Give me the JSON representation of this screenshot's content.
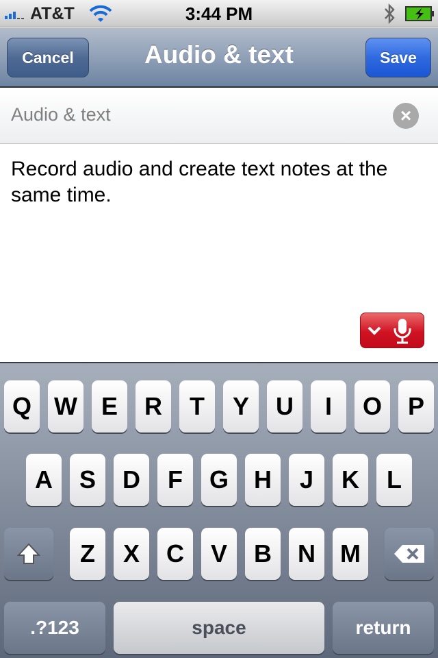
{
  "status_bar": {
    "carrier": "AT&T",
    "time": "3:44 PM",
    "signal_bars": 3,
    "battery": "charging",
    "icons": [
      "signal-icon",
      "wifi-icon",
      "bluetooth-icon",
      "battery-charging-icon"
    ]
  },
  "nav": {
    "cancel_label": "Cancel",
    "title": "Audio & text",
    "save_label": "Save"
  },
  "note": {
    "title_value": "Audio & text",
    "body": "Record audio and create text notes at the same time."
  },
  "mic_button": {
    "icons": [
      "chevron-down-icon",
      "microphone-icon"
    ],
    "color": "#d01323"
  },
  "keyboard": {
    "row1": [
      "Q",
      "W",
      "E",
      "R",
      "T",
      "Y",
      "U",
      "I",
      "O",
      "P"
    ],
    "row2": [
      "A",
      "S",
      "D",
      "F",
      "G",
      "H",
      "J",
      "K",
      "L"
    ],
    "row3": [
      "Z",
      "X",
      "C",
      "V",
      "B",
      "N",
      "M"
    ],
    "numbers_label": ".?123",
    "space_label": "space",
    "return_label": "return"
  }
}
